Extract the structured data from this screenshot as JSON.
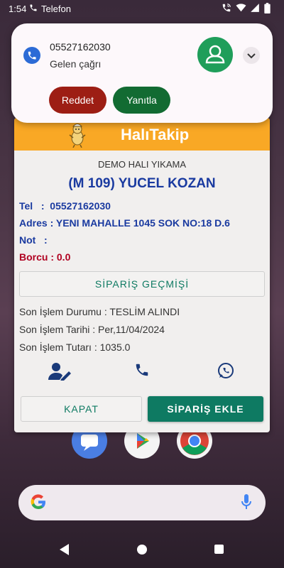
{
  "status_bar": {
    "time": "1:54",
    "app_name": "Telefon",
    "icons": [
      "phone-icon",
      "wifi-calling-icon",
      "wifi-icon",
      "signal-icon",
      "battery-icon"
    ]
  },
  "call_notification": {
    "phone_number": "05527162030",
    "status": "Gelen çağrı",
    "reject_label": "Reddet",
    "answer_label": "Yanıtla",
    "colors": {
      "reject": "#9d1e14",
      "answer": "#126b32",
      "avatar": "#1f9e5a"
    }
  },
  "dialog": {
    "app_title": "HalıTakip",
    "company": "DEMO HALI YIKAMA",
    "customer": "(M 109) YUCEL KOZAN",
    "phone_line": "Tel   :  05527162030",
    "address_line": "Adres : YENI MAHALLE 1045 SOK NO:18 D.6",
    "note_line": "Not   :",
    "debt_line": "Borcu : 0.0",
    "history_button": "SİPARİŞ GEÇMİŞİ",
    "last_status": "Son İşlem Durumu : TESLİM ALINDI",
    "last_date": "Son İşlem Tarihi : Per,11/04/2024",
    "last_amount": "Son İşlem Tutarı : 1035.0",
    "close_button": "KAPAT",
    "add_order_button": "SİPARİŞ EKLE",
    "colors": {
      "header": "#f9a825",
      "accent": "#0e7a62",
      "customer": "#1a3aa0",
      "debt": "#b00020"
    }
  },
  "home": {
    "dock_icons": [
      "messages-icon",
      "play-store-icon",
      "chrome-icon"
    ],
    "search_icons": [
      "google-logo-icon",
      "mic-icon"
    ]
  }
}
